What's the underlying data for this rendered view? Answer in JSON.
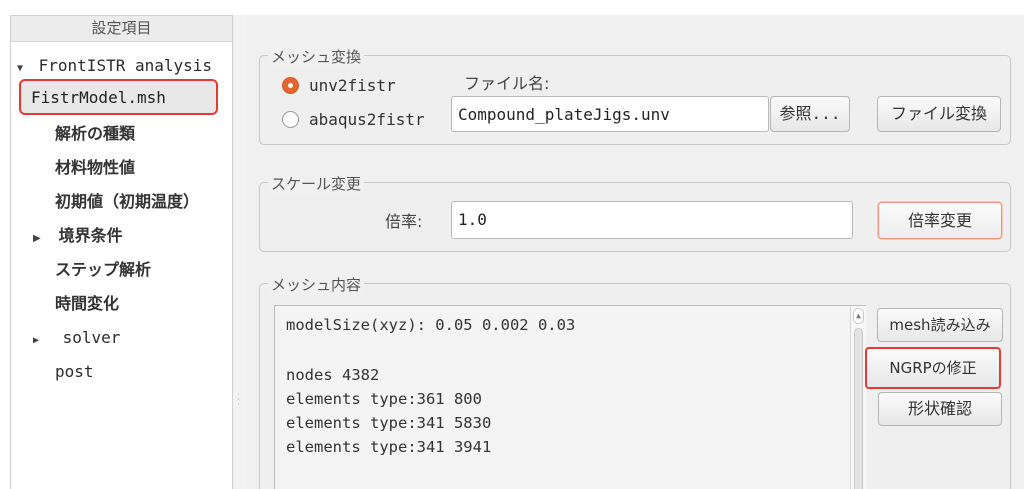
{
  "tree": {
    "header": "設定項目",
    "items": [
      {
        "label": "FrontISTR analysis",
        "arrow": "▼"
      },
      {
        "label": "FistrModel.msh"
      },
      {
        "label": "解析の種類"
      },
      {
        "label": "材料物性値"
      },
      {
        "label": "初期値（初期温度）"
      },
      {
        "label": "境界条件",
        "arrow": "▶"
      },
      {
        "label": "ステップ解析"
      },
      {
        "label": "時間変化"
      },
      {
        "label": "solver",
        "arrow": "▶"
      },
      {
        "label": "post"
      }
    ]
  },
  "mesh_convert": {
    "title": "メッシュ変換",
    "radio_unv": "unv2fistr",
    "radio_abaqus": "abaqus2fistr",
    "selected": "unv2fistr",
    "filename_label": "ファイル名:",
    "filename_value": "Compound_plateJigs.unv",
    "browse_button": "参照...",
    "convert_button": "ファイル変換"
  },
  "scale": {
    "title": "スケール変更",
    "ratio_label": "倍率:",
    "ratio_value": "1.0",
    "apply_button": "倍率変更"
  },
  "mesh_content": {
    "title": "メッシュ内容",
    "lines": [
      "modelSize(xyz): 0.05 0.002 0.03",
      "",
      "nodes 4382",
      "elements type:361 800",
      "elements type:341 5830",
      "elements type:341 3941"
    ],
    "load_button": "mesh読み込み",
    "ngrp_button": "NGRPの修正",
    "shape_button": "形状確認"
  },
  "colors": {
    "highlight": "#e53935",
    "radio_accent": "#e1672f"
  }
}
